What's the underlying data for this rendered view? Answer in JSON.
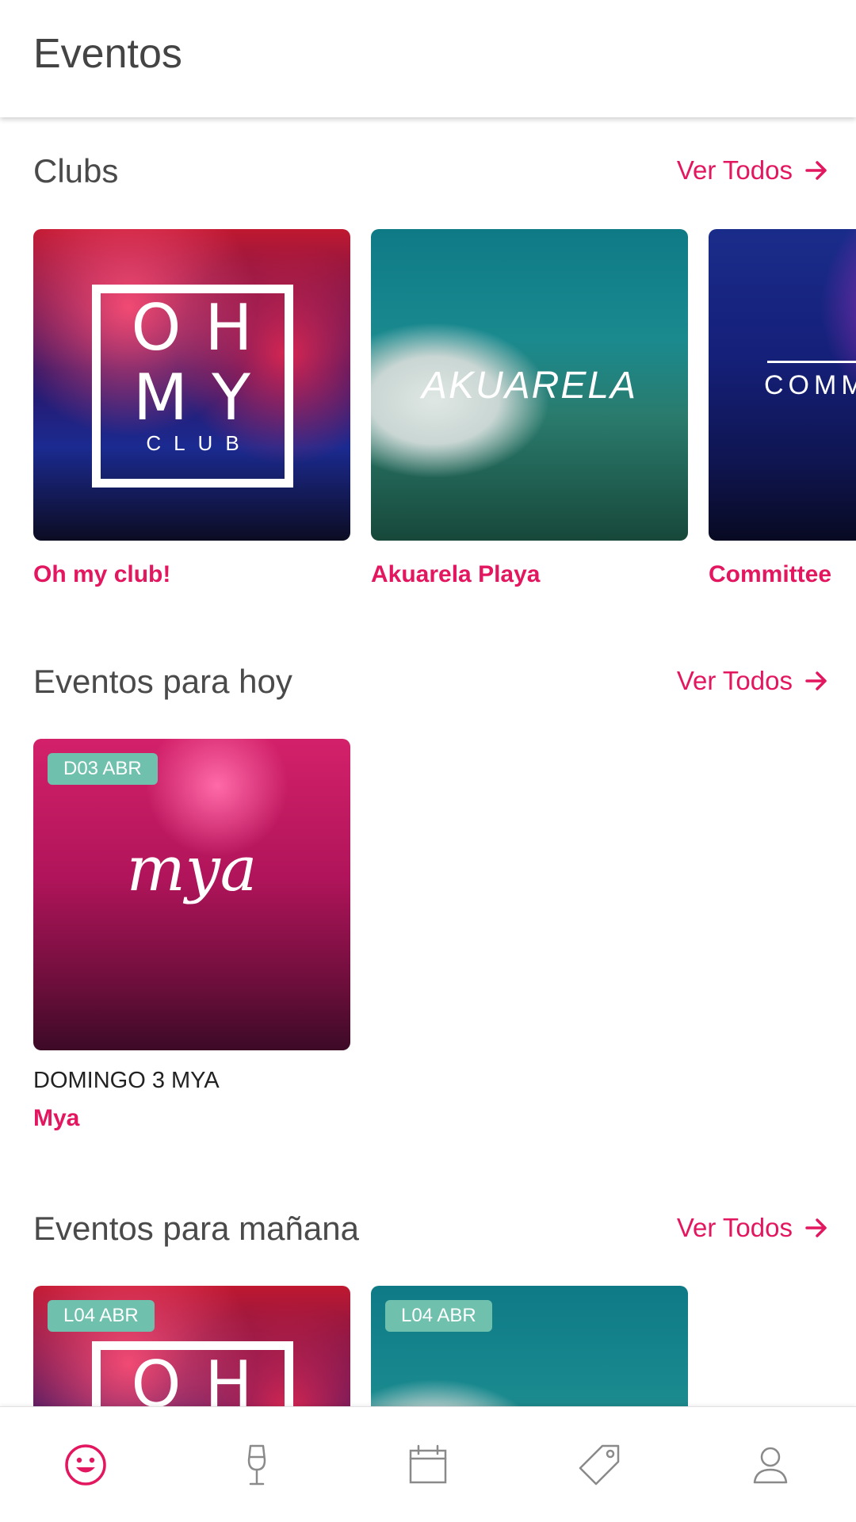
{
  "app_bar": {
    "title": "Eventos"
  },
  "clubs": {
    "title": "Clubs",
    "see_all": "Ver Todos",
    "items": [
      {
        "name": "Oh my club!",
        "logo_lines": [
          "OH",
          "MY"
        ],
        "logo_sub": "CLUB",
        "image": "oh-my-club-image"
      },
      {
        "name": "Akuarela Playa",
        "logo": "AKUARELA",
        "image": "akuarela-playa-image"
      },
      {
        "name": "Committee",
        "logo": "COMM",
        "image": "committee-image"
      }
    ]
  },
  "today": {
    "title": "Eventos para hoy",
    "see_all": "Ver Todos",
    "items": [
      {
        "badge": "D03 ABR",
        "title": "DOMINGO 3 MYA",
        "venue": "Mya",
        "logo": "mya",
        "image": "mya-event-image"
      }
    ]
  },
  "tomorrow": {
    "title": "Eventos para mañana",
    "see_all": "Ver Todos",
    "items": [
      {
        "badge": "L04 ABR",
        "image": "oh-my-club-event-image"
      },
      {
        "badge": "L04 ABR",
        "image": "akuarela-event-image"
      }
    ]
  },
  "bottom_nav": {
    "items": [
      {
        "icon": "smiley-icon",
        "active": true
      },
      {
        "icon": "wine-glass-icon",
        "active": false
      },
      {
        "icon": "calendar-icon",
        "active": false
      },
      {
        "icon": "tag-icon",
        "active": false
      },
      {
        "icon": "profile-icon",
        "active": false
      }
    ]
  },
  "colors": {
    "accent": "#e3175f",
    "badge": "#6fc0ad",
    "text": "#444444",
    "nav_inactive": "#8a8a8a"
  }
}
